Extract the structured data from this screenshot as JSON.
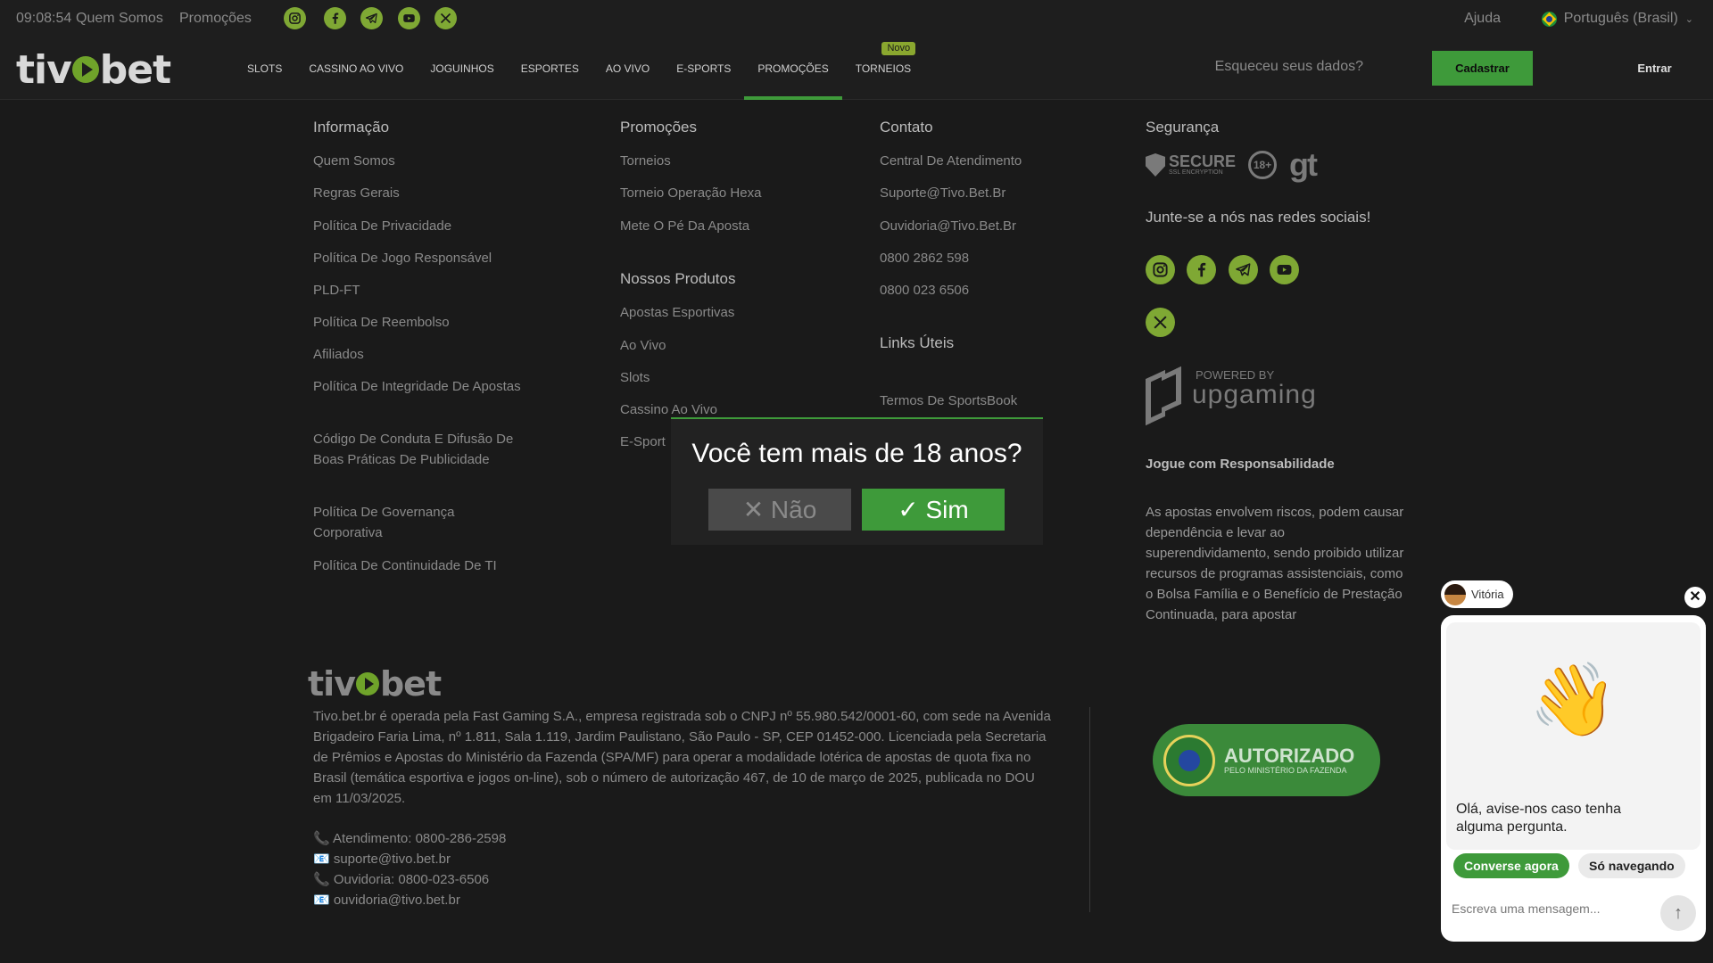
{
  "topbar": {
    "clock": "09:08:54",
    "links": [
      "Quem Somos",
      "Promoções"
    ],
    "help": "Ajuda",
    "language": "Português (Brasil)",
    "social_icons": [
      "instagram-icon",
      "facebook-icon",
      "telegram-icon",
      "youtube-icon",
      "x-icon"
    ]
  },
  "nav": {
    "logo": {
      "left": "tiv",
      "right": "bet"
    },
    "items": [
      {
        "label": "SLOTS"
      },
      {
        "label": "CASSINO AO VIVO"
      },
      {
        "label": "JOGUINHOS"
      },
      {
        "label": "ESPORTES"
      },
      {
        "label": "AO VIVO"
      },
      {
        "label": "E-SPORTS"
      },
      {
        "label": "PROMOÇÕES",
        "active": true
      },
      {
        "label": "TORNEIOS",
        "badge": "Novo"
      }
    ],
    "forgot": "Esqueceu seus dados?",
    "register": "Cadastrar",
    "login": "Entrar"
  },
  "footer": {
    "info": {
      "title": "Informação",
      "links": [
        "Quem Somos",
        "Regras Gerais",
        "Política De Privacidade",
        "Política De Jogo Responsável",
        "PLD-FT",
        "Política De Reembolso",
        "Afiliados",
        "Política De Integridade De Apostas",
        "Código De Conduta E Difusão De Boas Práticas De Publicidade",
        "Política De Governança Corporativa",
        "Política De Continuidade De TI"
      ]
    },
    "promo": {
      "title": "Promoções",
      "links": [
        "Torneios",
        "Torneio Operação Hexa",
        "Mete O Pé Da Aposta"
      ]
    },
    "products": {
      "title": "Nossos Produtos",
      "links": [
        "Apostas Esportivas",
        "Ao Vivo",
        "Slots",
        "Cassino Ao Vivo",
        "E-Sport"
      ]
    },
    "contact": {
      "title": "Contato",
      "links": [
        "Central De Atendimento",
        "Suporte@Tivo.Bet.Br",
        "Ouvidoria@Tivo.Bet.Br",
        "0800 2862 598",
        "0800 023 6506"
      ]
    },
    "useful": {
      "title": "Links Úteis",
      "links": [
        "Termos De SportsBook"
      ]
    },
    "security": {
      "title": "Segurança",
      "secure": "SECURE",
      "secure_sub": "SSL ENCRYPTION",
      "age": "18+",
      "gt": "gt",
      "join": "Junte-se a nós nas redes sociais!",
      "powered_by": "POWERED BY",
      "upgaming": "upgaming",
      "resp_title": "Jogue com Responsabilidade",
      "resp_text": "As apostas envolvem riscos, podem causar dependência e levar ao superendividamento, sendo proibido utilizar recursos de programas assistenciais, como o Bolsa Família e o Benefício de Prestação Continuada, para apostar"
    }
  },
  "bottom": {
    "legal": "Tivo.bet.br é operada pela Fast Gaming S.A., empresa registrada sob o CNPJ nº 55.980.542/0001-60, com sede na Avenida Brigadeiro Faria Lima, nº 1.811, Sala 1.119, Jardim Paulistano, São Paulo - SP, CEP 01452-000. Licenciada pela Secretaria de Prêmios e Apostas do Ministério da Fazenda (SPA/MF) para operar a modalidade lotérica de apostas de quota fixa no Brasil (temática esportiva e jogos on-line), sob o número de autorização 467, de 10 de março de 2025, publicada no DOU em 11/03/2025.",
    "contacts": [
      "📞 Atendimento: 0800-286-2598",
      "📧 suporte@tivo.bet.br",
      "📞 Ouvidoria: 0800-023-6506",
      "📧 ouvidoria@tivo.bet.br"
    ],
    "badge_title": "AUTORIZADO",
    "badge_sub": "PELO MINISTÉRIO DA FAZENDA"
  },
  "modal": {
    "question": "Você tem mais de 18 anos?",
    "no": "✕ Não",
    "yes": "✓ Sim"
  },
  "chat": {
    "agent": "Vitória",
    "close": "✕",
    "wave": "👋",
    "message": "Olá, avise-nos caso tenha alguma pergunta.",
    "talk_now": "Converse agora",
    "browsing": "Só navegando",
    "placeholder": "Escreva uma mensagem...",
    "send": "↑"
  },
  "colors": {
    "accent": "#3e9a3a",
    "social": "#7fa834",
    "background": "#1a1a1a"
  }
}
